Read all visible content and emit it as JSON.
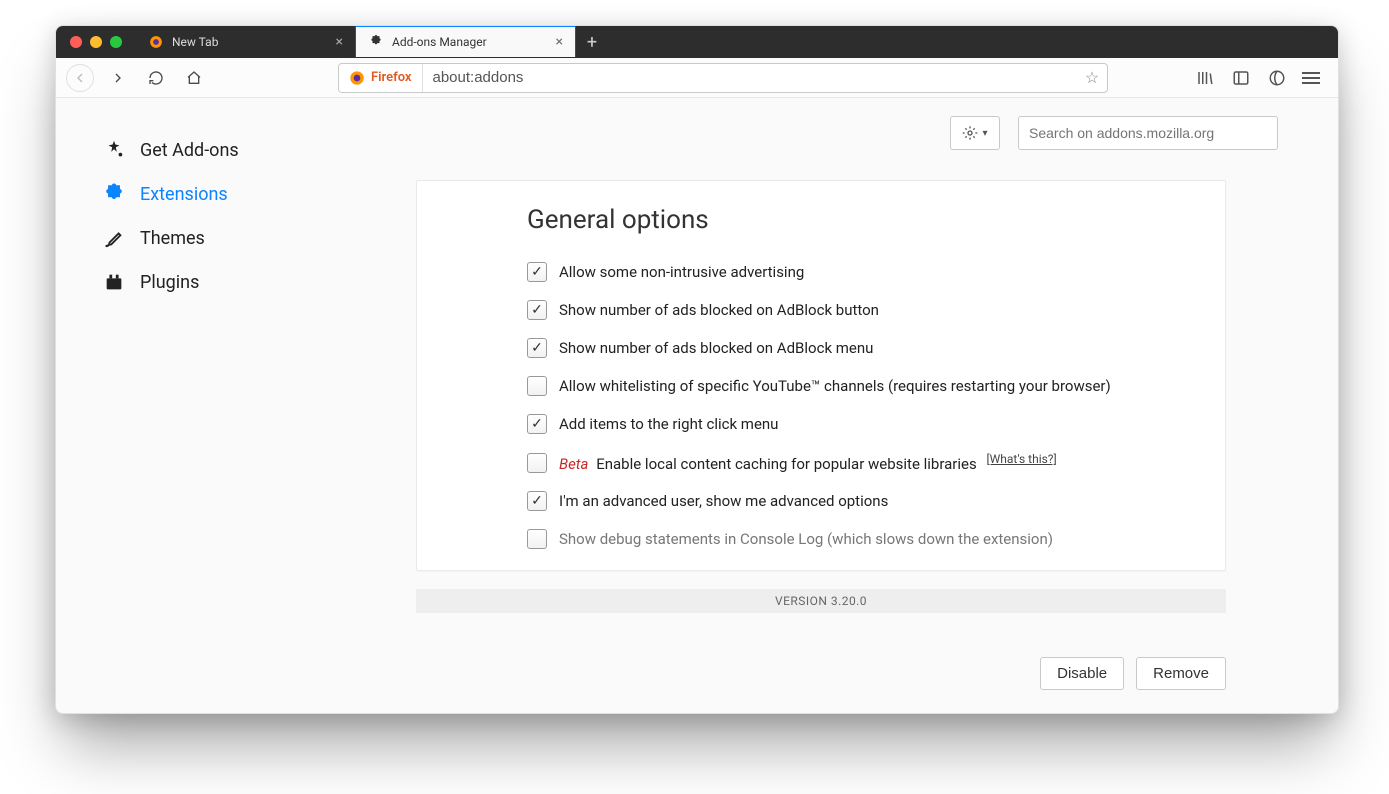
{
  "tabs": {
    "items": [
      {
        "label": "New Tab",
        "active": false
      },
      {
        "label": "Add-ons Manager",
        "active": true
      }
    ]
  },
  "nav": {
    "identity_label": "Firefox",
    "url_value": "about:addons"
  },
  "toolbar": {
    "search_placeholder": "Search on addons.mozilla.org"
  },
  "sidebar": {
    "items": [
      {
        "key": "get-addons",
        "label": "Get Add-ons"
      },
      {
        "key": "extensions",
        "label": "Extensions"
      },
      {
        "key": "themes",
        "label": "Themes"
      },
      {
        "key": "plugins",
        "label": "Plugins"
      }
    ],
    "active": "extensions"
  },
  "panel": {
    "heading": "General options",
    "options": [
      {
        "checked": true,
        "label": "Allow some non-intrusive advertising"
      },
      {
        "checked": true,
        "label": "Show number of ads blocked on AdBlock button"
      },
      {
        "checked": true,
        "label": "Show number of ads blocked on AdBlock menu"
      },
      {
        "checked": false,
        "label": "Allow whitelisting of specific YouTube™ channels (requires restarting your browser)"
      },
      {
        "checked": true,
        "label": "Add items to the right click menu"
      },
      {
        "checked": false,
        "beta_prefix": "Beta",
        "label": "Enable local content caching for popular website libraries",
        "whats_this": "[What's this?]"
      },
      {
        "checked": true,
        "label": "I'm an advanced user, show me advanced options"
      },
      {
        "checked": false,
        "muted": true,
        "label": "Show debug statements in Console Log (which slows down the extension)"
      }
    ],
    "version_text": "VERSION 3.20.0",
    "disable_label": "Disable",
    "remove_label": "Remove"
  }
}
